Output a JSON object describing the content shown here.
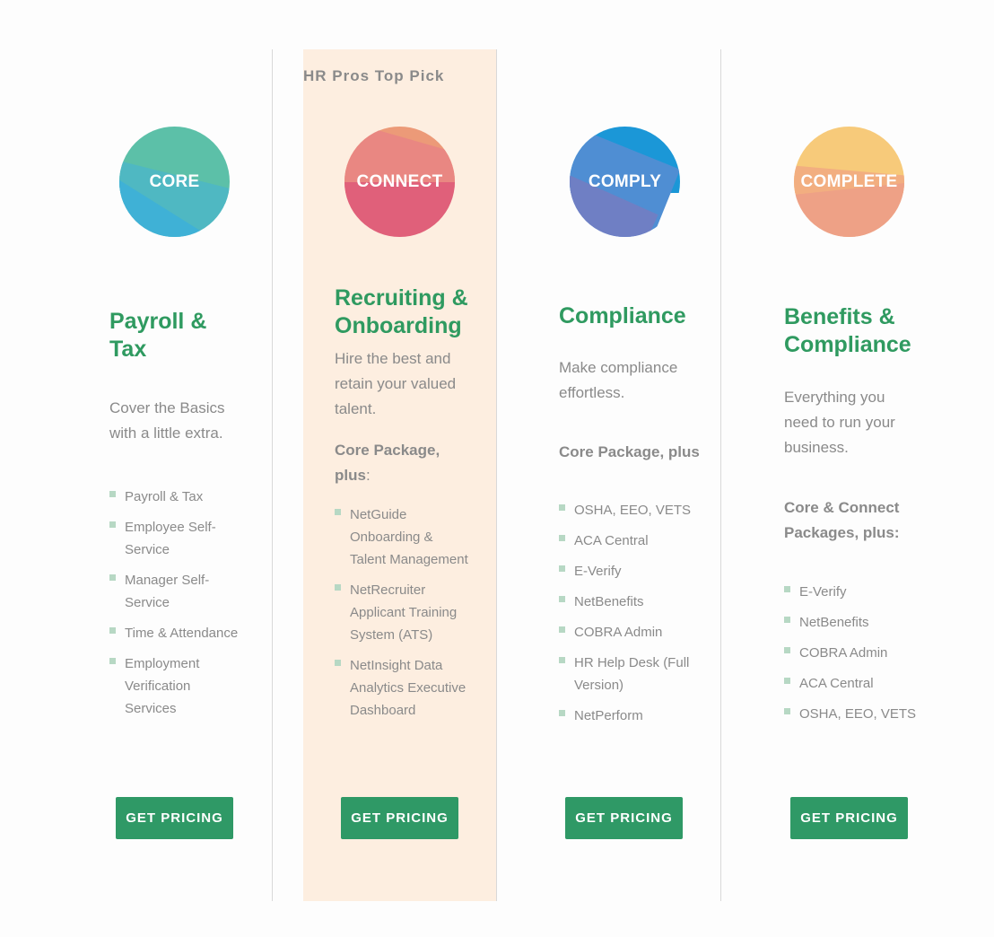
{
  "highlight_badge": "HR Pros Top Pick",
  "colors": {
    "accent_green": "#2f9a60",
    "button_green": "#2f9966",
    "highlight_bg": "#fdeee0",
    "bullet": "#b7d8c4"
  },
  "plans": [
    {
      "badge": "CORE",
      "title": "Payroll & Tax",
      "description": "Cover the Basics with a little extra.",
      "subheading": "",
      "features": [
        "Payroll & Tax",
        "Employee Self-Service",
        "Manager Self-Service",
        "Time & Attendance",
        "Employment Verification Services"
      ],
      "button": "GET PRICING",
      "circle_colors": [
        "#5cc0a8",
        "#4fb8c2",
        "#3fb1d6"
      ]
    },
    {
      "badge": "CONNECT",
      "title": "Recruiting & Onboarding",
      "description": "Hire the best and retain your valued talent.",
      "subheading": "Core Package, plus",
      "subheading_suffix": ":",
      "features": [
        "NetGuide Onboarding & Talent Management",
        "NetRecruiter Applicant Training System (ATS)",
        "NetInsight Data Analytics Executive Dashboard"
      ],
      "button": "GET PRICING",
      "circle_colors": [
        "#ec9a78",
        "#e98782",
        "#e0607a"
      ]
    },
    {
      "badge": "COMPLY",
      "title": "Compliance",
      "description": "Make compliance effortless.",
      "subheading": "Core Package, plus",
      "features": [
        "OSHA, EEO, VETS",
        "ACA Central",
        "E-Verify",
        "NetBenefits",
        "COBRA Admin",
        "HR Help Desk (Full Version)",
        "NetPerform"
      ],
      "button": "GET PRICING",
      "circle_colors": [
        "#1b97d7",
        "#4f8ed3",
        "#6f7fc4"
      ]
    },
    {
      "badge": "COMPLETE",
      "title": "Benefits & Compliance",
      "description": "Everything you need to run your business.",
      "subheading": "Core & Connect Packages, plus:",
      "features": [
        "E-Verify",
        "NetBenefits",
        "COBRA Admin",
        "ACA Central",
        "OSHA, EEO, VETS"
      ],
      "button": "GET PRICING",
      "circle_colors": [
        "#f7ca7a",
        "#f2ae80",
        "#eea186"
      ]
    }
  ]
}
